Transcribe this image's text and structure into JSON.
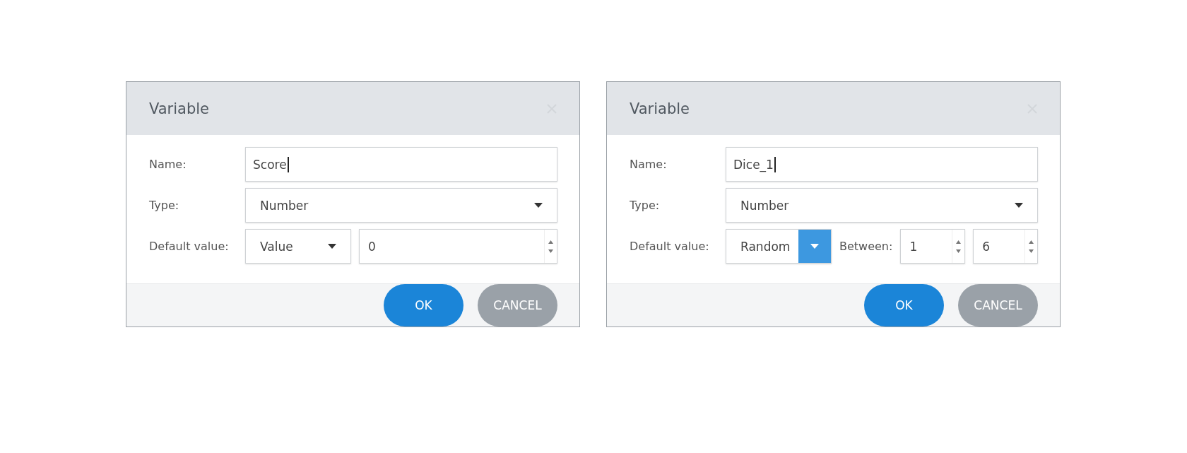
{
  "dialogs": [
    {
      "title": "Variable",
      "fields": [
        {
          "kind": "text",
          "label": "Name:",
          "value": "Score"
        },
        {
          "kind": "select",
          "label": "Type:",
          "value": "Number"
        },
        {
          "kind": "default",
          "label": "Default value:",
          "select": {
            "value": "Value",
            "highlighted": false
          },
          "inputs": [
            {
              "value": "0"
            }
          ]
        }
      ],
      "buttons": [
        {
          "kind": "primary",
          "label": "OK"
        },
        {
          "kind": "secondary",
          "label": "CANCEL"
        }
      ]
    },
    {
      "title": "Variable",
      "fields": [
        {
          "kind": "text",
          "label": "Name:",
          "value": "Dice_1"
        },
        {
          "kind": "select",
          "label": "Type:",
          "value": "Number"
        },
        {
          "kind": "default",
          "label": "Default value:",
          "select": {
            "value": "Random",
            "highlighted": true
          },
          "between_label": "Between:",
          "inputs": [
            {
              "value": "1"
            },
            {
              "value": "6"
            }
          ]
        }
      ],
      "buttons": [
        {
          "kind": "primary",
          "label": "OK"
        },
        {
          "kind": "secondary",
          "label": "CANCEL"
        }
      ]
    }
  ]
}
